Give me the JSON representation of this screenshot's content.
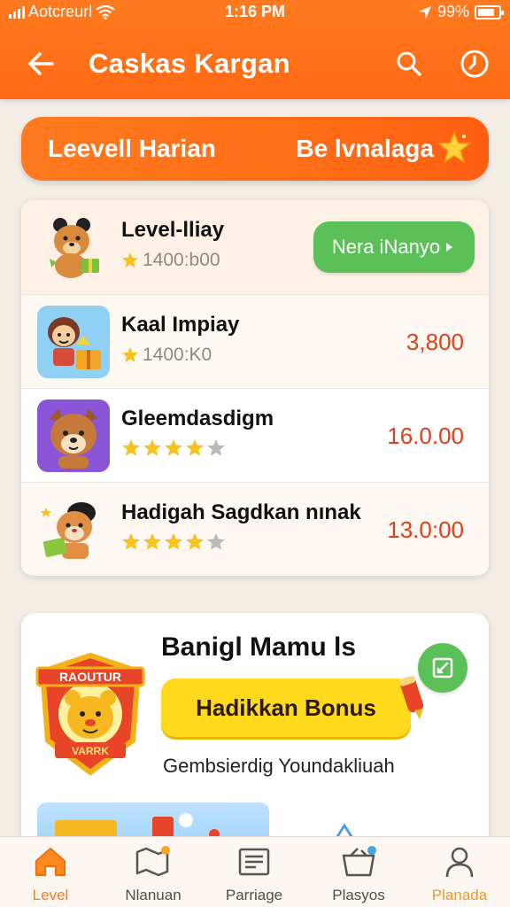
{
  "status_bar": {
    "carrier": "Aotcreurl",
    "time": "1:16 PM",
    "battery": "99%"
  },
  "header": {
    "title": "Caskas Kargan",
    "icons": [
      "back-arrow-icon",
      "search-icon",
      "clock-icon"
    ]
  },
  "banner": {
    "left_label": "Leevell Harian",
    "right_label": "Be lvnalaga",
    "icon": "star-icon"
  },
  "levels": [
    {
      "name": "Level-lliay",
      "sub": "1400:b00",
      "action_label": "Nera iNanyo",
      "action_icon": "chevron-right-icon"
    },
    {
      "name": "Kaal Impiay",
      "sub": "1400:K0",
      "value": "3,800"
    },
    {
      "name": "Gleemdasdigm",
      "stars": 4,
      "max_stars": 5,
      "value": "16.0.00"
    },
    {
      "name": "Hadigah Sagdkan nınak",
      "stars": 4,
      "max_stars": 5,
      "value": "13.0:00"
    }
  ],
  "bonus": {
    "title": "Banigl Mamu ls",
    "button_label": "Hadikkan Bonus",
    "description": "Gembsierdig Youndakliuah",
    "badge_top_text": "RAOUTUR",
    "badge_bottom_text": "VARRK",
    "edit_icon": "edit-icon"
  },
  "bottom_nav": [
    {
      "label": "Level",
      "icon": "home-icon",
      "active": true
    },
    {
      "label": "Nlanuan",
      "icon": "map-icon",
      "active": false
    },
    {
      "label": "Parriage",
      "icon": "news-icon",
      "active": false
    },
    {
      "label": "Plasyos",
      "icon": "basket-icon",
      "active": false
    },
    {
      "label": "Planada",
      "icon": "profile-icon",
      "active": false
    }
  ],
  "colors": {
    "accent": "#ff7a1e",
    "play_green": "#5cc059",
    "value_red": "#d9421d",
    "bonus_yellow": "#ffd91c",
    "star_yellow": "#f6c21b",
    "star_grey": "#b9b9b9"
  }
}
